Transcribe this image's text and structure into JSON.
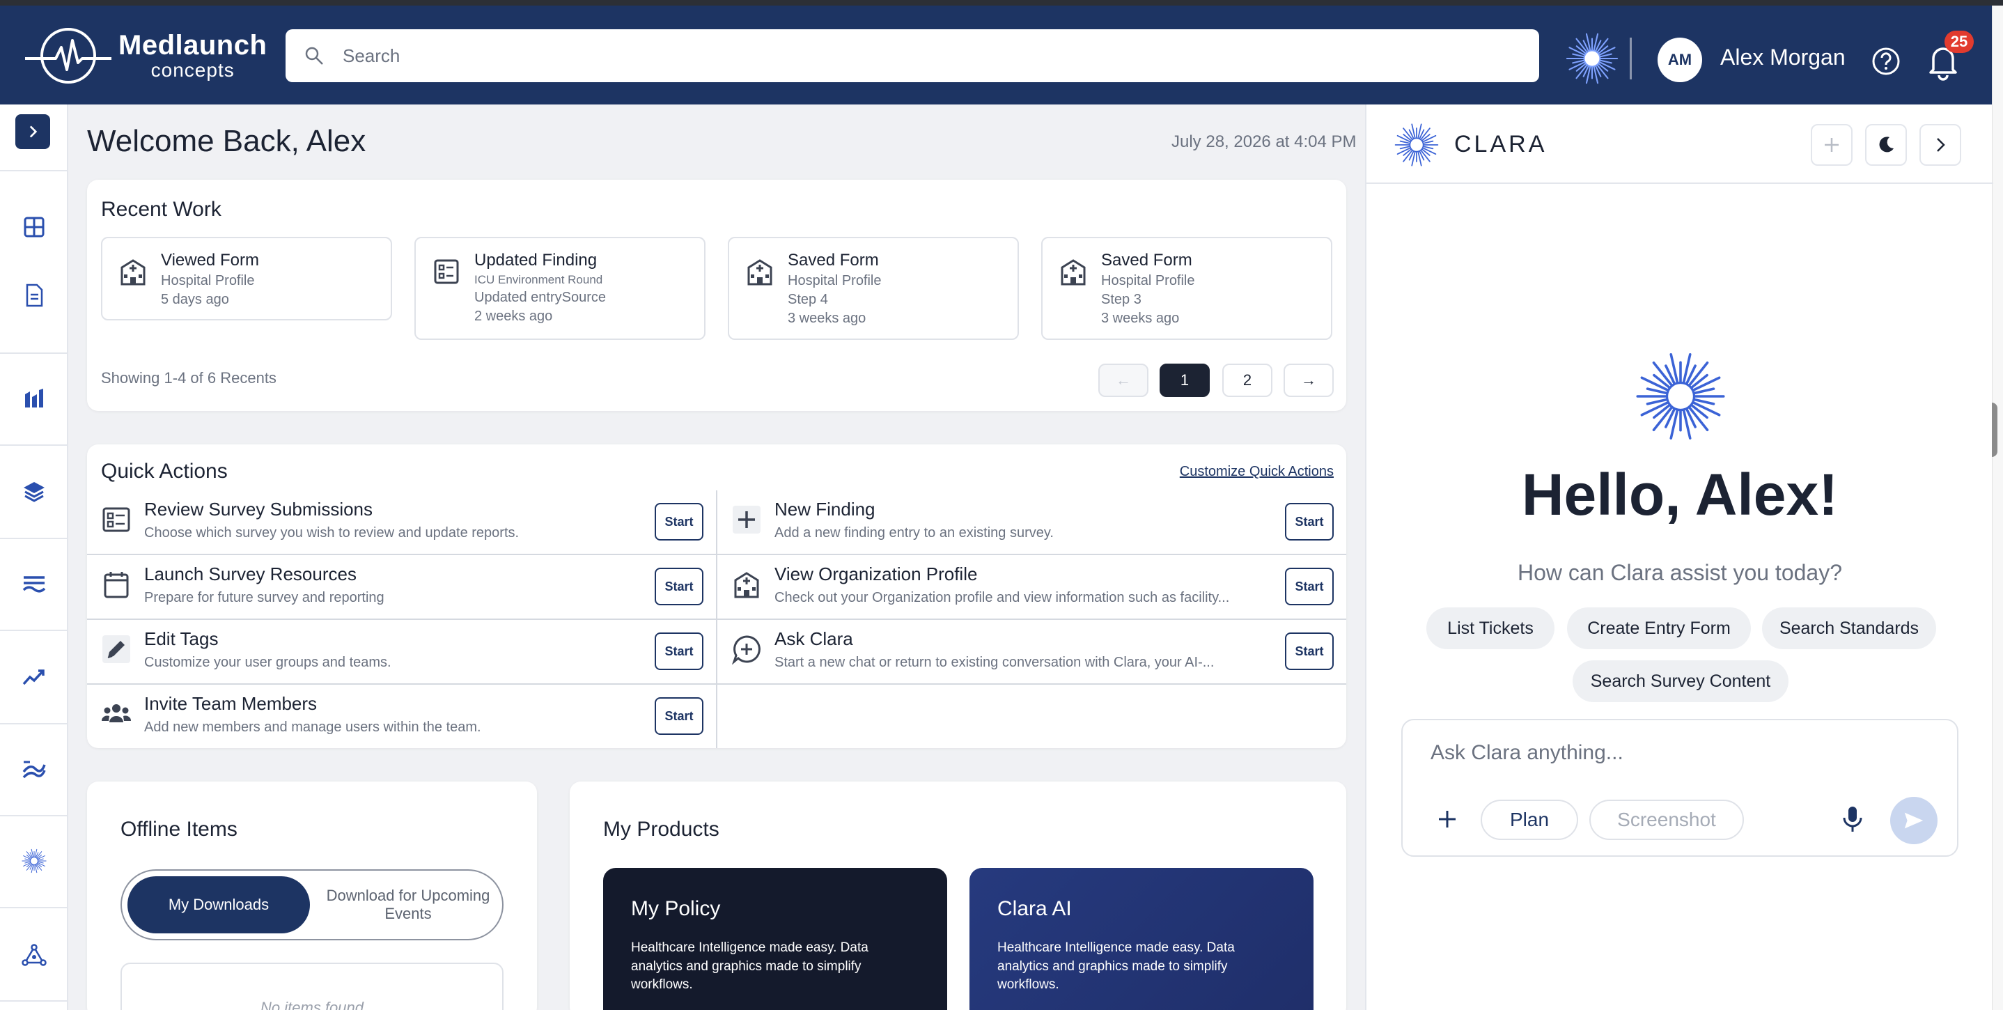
{
  "brand": {
    "name": "Medlaunch",
    "sub": "concepts"
  },
  "search": {
    "placeholder": "Search"
  },
  "user": {
    "initials": "AM",
    "name": "Alex Morgan",
    "notifications": "25"
  },
  "welcome": {
    "title": "Welcome Back, Alex",
    "datetime": "July 28, 2026 at 4:04 PM"
  },
  "recent": {
    "title": "Recent Work",
    "items": [
      {
        "title": "Viewed Form",
        "lines": [
          "Hospital Profile",
          "5 days ago"
        ]
      },
      {
        "title": "Updated Finding",
        "lines": [
          "ICU Environment Round",
          "Updated entrySource",
          "2 weeks ago"
        ]
      },
      {
        "title": "Saved Form",
        "lines": [
          "Hospital Profile",
          "Step 4",
          "3 weeks ago"
        ]
      },
      {
        "title": "Saved Form",
        "lines": [
          "Hospital Profile",
          "Step 3",
          "3 weeks ago"
        ]
      }
    ],
    "showing": "Showing 1-4 of 6 Recents",
    "pages": [
      "1",
      "2"
    ],
    "prev": "←",
    "next": "→"
  },
  "quick": {
    "title": "Quick Actions",
    "customize": "Customize Quick Actions",
    "start_label": "Start",
    "left": [
      {
        "title": "Review Survey Submissions",
        "desc": "Choose which survey you wish to review and update reports."
      },
      {
        "title": "Launch Survey Resources",
        "desc": "Prepare for future survey and reporting"
      },
      {
        "title": "Edit Tags",
        "desc": "Customize your user groups and teams."
      },
      {
        "title": "Invite Team Members",
        "desc": "Add new members and manage users within the team."
      }
    ],
    "right": [
      {
        "title": "New Finding",
        "desc": "Add a new finding entry to an existing survey."
      },
      {
        "title": "View Organization Profile",
        "desc": "Check out your Organization profile and view information such as facility..."
      },
      {
        "title": "Ask Clara",
        "desc": "Start a new chat or return to existing conversation with Clara, your AI-..."
      }
    ]
  },
  "offline": {
    "title": "Offline Items",
    "tab_active": "My Downloads",
    "tab_inactive": "Download for Upcoming Events",
    "empty": "No items found"
  },
  "products": {
    "title": "My Products",
    "items": [
      {
        "title": "My Policy",
        "desc": "Healthcare Intelligence made easy. Data analytics and graphics made to simplify workflows.",
        "color": "#141a2c"
      },
      {
        "title": "Clara AI",
        "desc": "Healthcare Intelligence made easy. Data analytics and graphics made to simplify workflows.",
        "color": "#263a7e"
      }
    ]
  },
  "clara": {
    "name": "CLARA",
    "hello": "Hello, Alex!",
    "prompt": "How can Clara assist you today?",
    "chips": [
      "List Tickets",
      "Create Entry Form",
      "Search Standards",
      "Search Survey Content"
    ],
    "input_placeholder": "Ask Clara anything...",
    "plan": "Plan",
    "screenshot": "Screenshot"
  },
  "colors": {
    "navy": "#1d3463",
    "accent_blue": "#3b63d6",
    "badge_red": "#e23b2e"
  }
}
